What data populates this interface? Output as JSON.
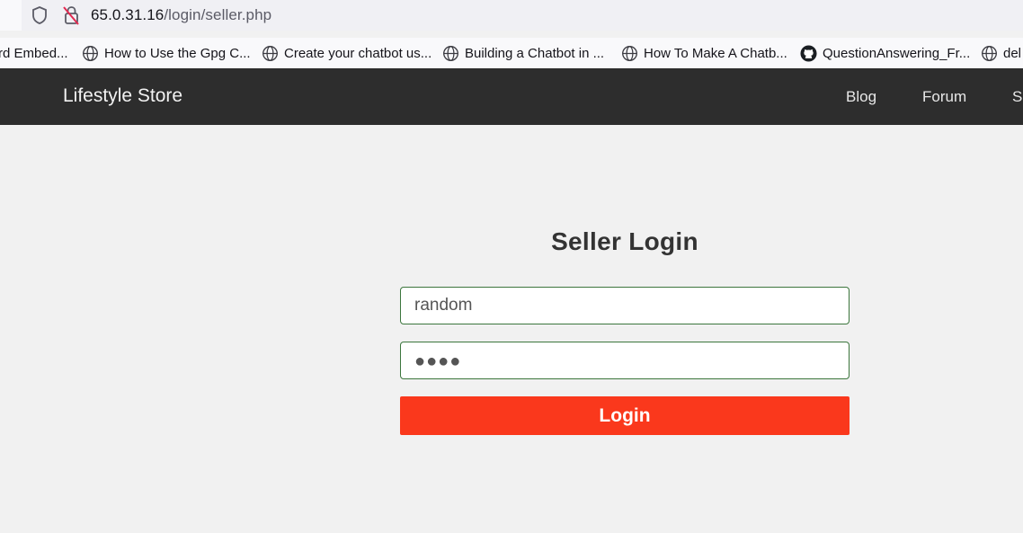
{
  "browser": {
    "url_host": "65.0.31.16",
    "url_path": "/login/seller.php",
    "bookmarks": [
      {
        "label": "rd Embed...",
        "icon": "globe-icon"
      },
      {
        "label": "How to Use the Gpg C...",
        "icon": "globe-icon"
      },
      {
        "label": "Create your chatbot us...",
        "icon": "globe-icon"
      },
      {
        "label": "Building a Chatbot in ...",
        "icon": "globe-icon"
      },
      {
        "label": "How To Make A Chatb...",
        "icon": "globe-icon"
      },
      {
        "label": "QuestionAnswering_Fr...",
        "icon": "github-icon"
      },
      {
        "label": "del",
        "icon": "globe-icon"
      }
    ]
  },
  "navbar": {
    "brand": "Lifestyle Store",
    "links": [
      "Blog",
      "Forum",
      "Si"
    ],
    "background": "#2d2d2d"
  },
  "login": {
    "title": "Seller Login",
    "username_value": "random",
    "password_mask": "●●●●",
    "button_label": "Login",
    "button_color": "#fa381c",
    "field_border_color": "#3c763d"
  }
}
